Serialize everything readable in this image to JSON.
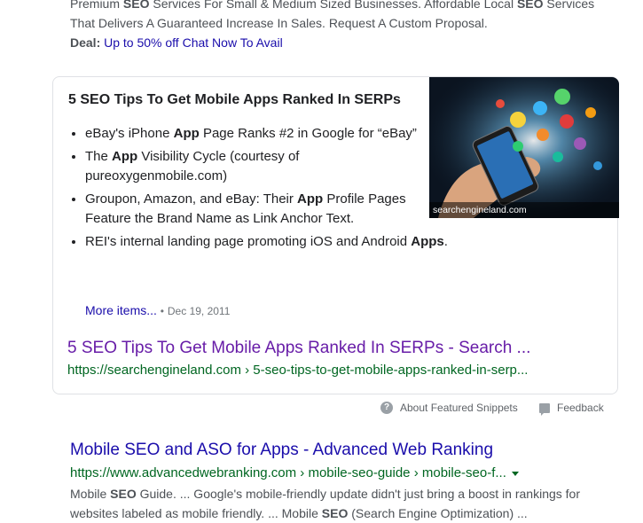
{
  "top_result": {
    "desc_line1_a": "Premium ",
    "desc_line1_b": "SEO",
    "desc_line1_c": " Services For Small & Medium Sized Businesses. Affordable Local ",
    "desc_line1_d": "SEO",
    "desc_line1_e": " Services",
    "desc_line2": "That Delivers A Guaranteed Increase In Sales. Request A Custom Proposal.",
    "deal_label": "Deal:",
    "deal_link": "Up to 50% off Chat Now To Avail"
  },
  "featured_snippet": {
    "heading": "5 SEO Tips To Get Mobile Apps Ranked In SERPs",
    "image_caption": "searchengineland.com",
    "items": [
      {
        "a": "eBay's iPhone ",
        "b": "App",
        "c": " Page Ranks #2 in Google for “eBay”"
      },
      {
        "a": "The ",
        "b": "App",
        "c": " Visibility Cycle (courtesy of pureoxygenmobile.com)"
      },
      {
        "a": "Groupon, Amazon, and eBay: Their ",
        "b": "App",
        "c": " Profile Pages Feature the Brand Name as Link Anchor Text."
      },
      {
        "a": "REI's internal landing page promoting iOS and Android ",
        "b": "Apps",
        "c": "."
      }
    ],
    "more_items": "More items...",
    "bullet_sep": "•",
    "date": "Dec 19, 2011",
    "result_title": "5 SEO Tips To Get Mobile Apps Ranked In SERPs - Search ...",
    "result_url": "https://searchengineland.com › 5-seo-tips-to-get-mobile-apps-ranked-in-serp..."
  },
  "feedback_row": {
    "about_label": "About Featured Snippets",
    "about_icon": "question-icon",
    "feedback_label": "Feedback",
    "feedback_icon": "feedback-icon"
  },
  "second_result": {
    "title": "Mobile SEO and ASO for Apps - Advanced Web Ranking",
    "url": "https://www.advancedwebranking.com › mobile-seo-guide › mobile-seo-f...",
    "desc_a": "Mobile ",
    "desc_b": "SEO",
    "desc_c": " Guide. ... Google's mobile-friendly update didn't just bring a boost in rankings for",
    "desc_line2_a": "websites labeled as mobile friendly. ... Mobile ",
    "desc_line2_b": "SEO",
    "desc_line2_c": " (Search Engine Optimization) ..."
  },
  "colors": {
    "link": "#1a0dab",
    "visited": "#681da8",
    "url_green": "#006621",
    "snippet_text": "#4d5156"
  }
}
